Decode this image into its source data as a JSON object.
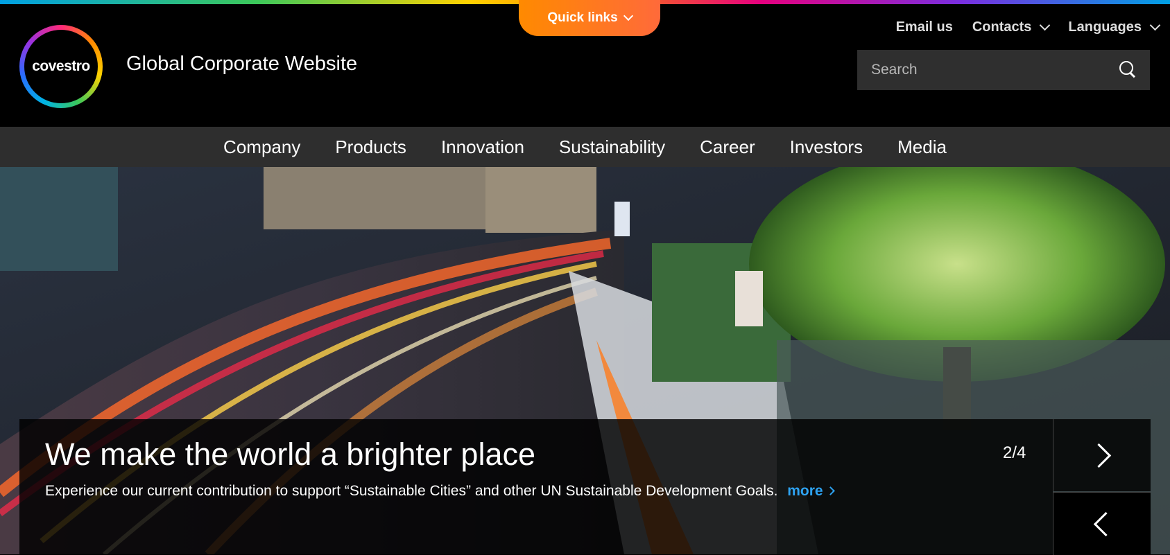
{
  "brand": {
    "logo_text": "covestro",
    "site_title": "Global Corporate Website"
  },
  "quick_links": {
    "label": "Quick links"
  },
  "top_links": [
    {
      "label": "Email us",
      "dropdown": false
    },
    {
      "label": "Contacts",
      "dropdown": true
    },
    {
      "label": "Languages",
      "dropdown": true
    }
  ],
  "search": {
    "placeholder": "Search",
    "value": ""
  },
  "nav": [
    "Company",
    "Products",
    "Innovation",
    "Sustainability",
    "Career",
    "Investors",
    "Media"
  ],
  "hero": {
    "headline": "We make the world a brighter place",
    "description": "Experience our current contribution to support “Sustainable Cities” and other UN Sustainable Development Goals.",
    "more_label": "more",
    "counter": "2/4"
  },
  "colors": {
    "accent_orange": "#ff8a00",
    "link_blue": "#2ea3f2",
    "nav_bg": "#2e2e2e"
  }
}
